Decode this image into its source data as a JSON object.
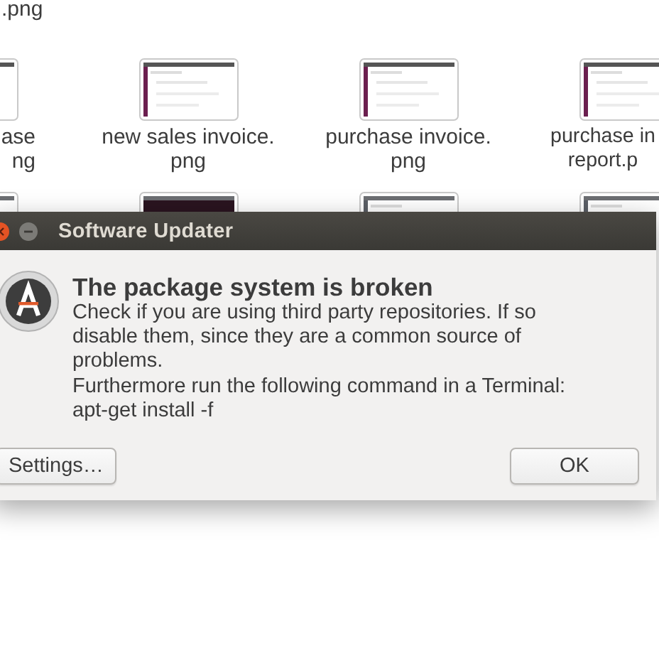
{
  "file_manager": {
    "top_caption": ".png",
    "files": [
      {
        "kind": "cut_left",
        "caption_lines": [
          "ase",
          "ng"
        ]
      },
      {
        "kind": "whole",
        "caption_lines": [
          "new sales invoice.",
          "png"
        ]
      },
      {
        "kind": "whole",
        "caption_lines": [
          "purchase invoice.",
          "png"
        ]
      },
      {
        "kind": "cut_right",
        "caption_lines": [
          "purchase in",
          "report.p"
        ]
      }
    ]
  },
  "dialog": {
    "title": "Software Updater",
    "heading": "The package system is broken",
    "message_lines": [
      "Check if you are using third party repositories. If so disable them, since they are a common source of problems.",
      "Furthermore run the following command in a Terminal:",
      "apt-get install -f"
    ],
    "buttons": [
      {
        "label": "Settings…",
        "kind": "left"
      },
      {
        "label": "OK",
        "kind": "right"
      }
    ]
  }
}
